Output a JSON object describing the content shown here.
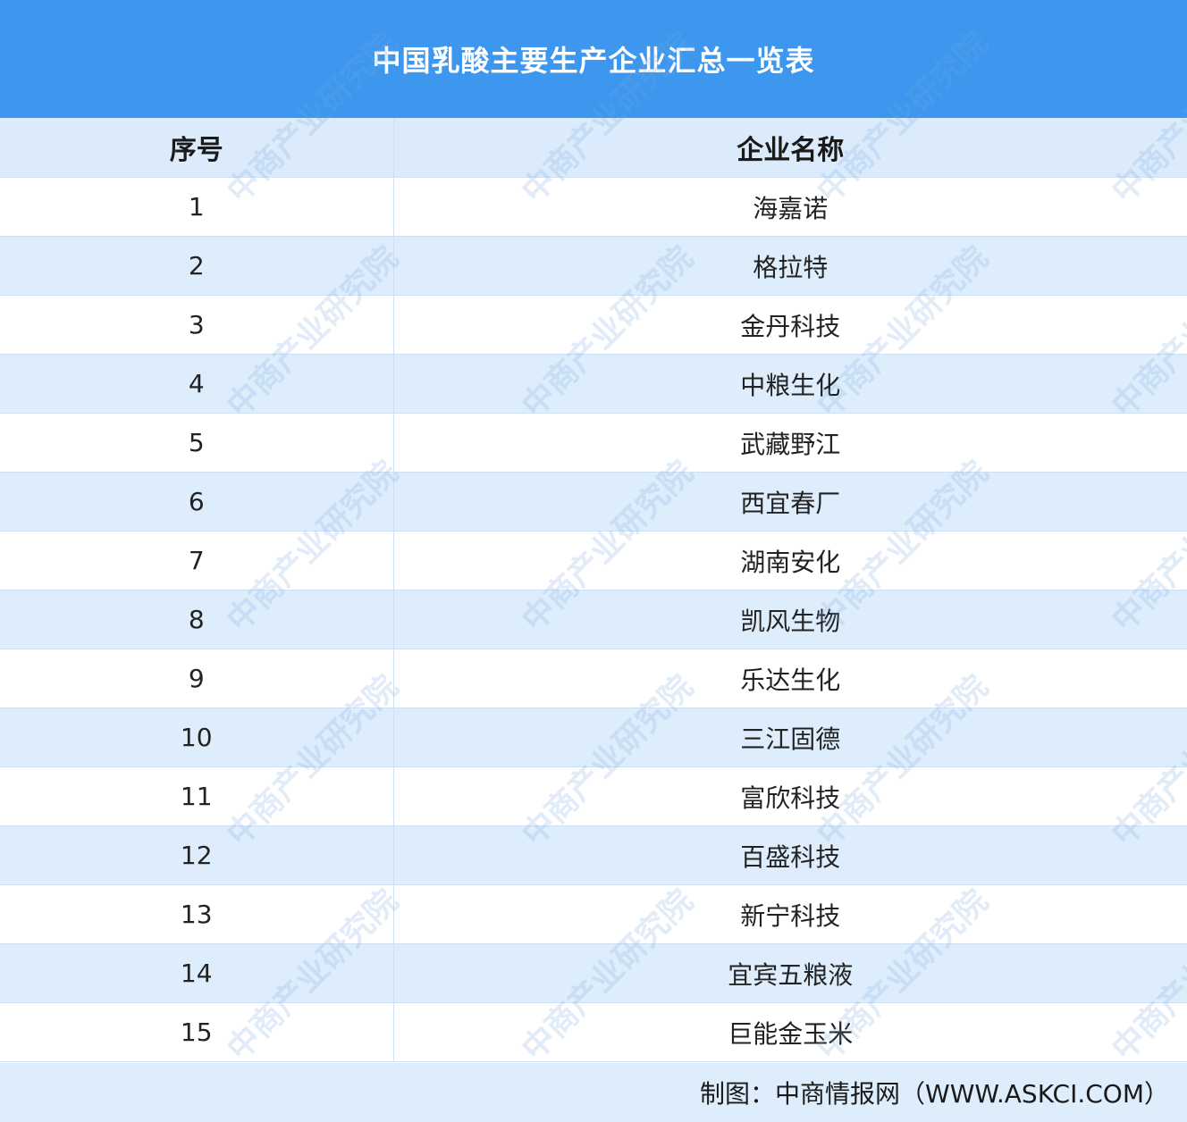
{
  "title": "中国乳酸主要生产企业汇总一览表",
  "table": {
    "headers": [
      "序号",
      "企业名称"
    ],
    "rows": [
      [
        "1",
        "海嘉诺"
      ],
      [
        "2",
        "格拉特"
      ],
      [
        "3",
        "金丹科技"
      ],
      [
        "4",
        "中粮生化"
      ],
      [
        "5",
        "武藏野江"
      ],
      [
        "6",
        "西宜春厂"
      ],
      [
        "7",
        "湖南安化"
      ],
      [
        "8",
        "凯风生物"
      ],
      [
        "9",
        "乐达生化"
      ],
      [
        "10",
        "三江固德"
      ],
      [
        "11",
        "富欣科技"
      ],
      [
        "12",
        "百盛科技"
      ],
      [
        "13",
        "新宁科技"
      ],
      [
        "14",
        "宜宾五粮液"
      ],
      [
        "15",
        "巨能金玉米"
      ]
    ]
  },
  "footer": "制图：中商情报网（WWW.ASKCI.COM）",
  "watermark": "中商产业研究院",
  "colors": {
    "title_bg": "#3d97ee",
    "row_alt_bg": "#deedfc",
    "header_bg": "#dcebfb"
  }
}
